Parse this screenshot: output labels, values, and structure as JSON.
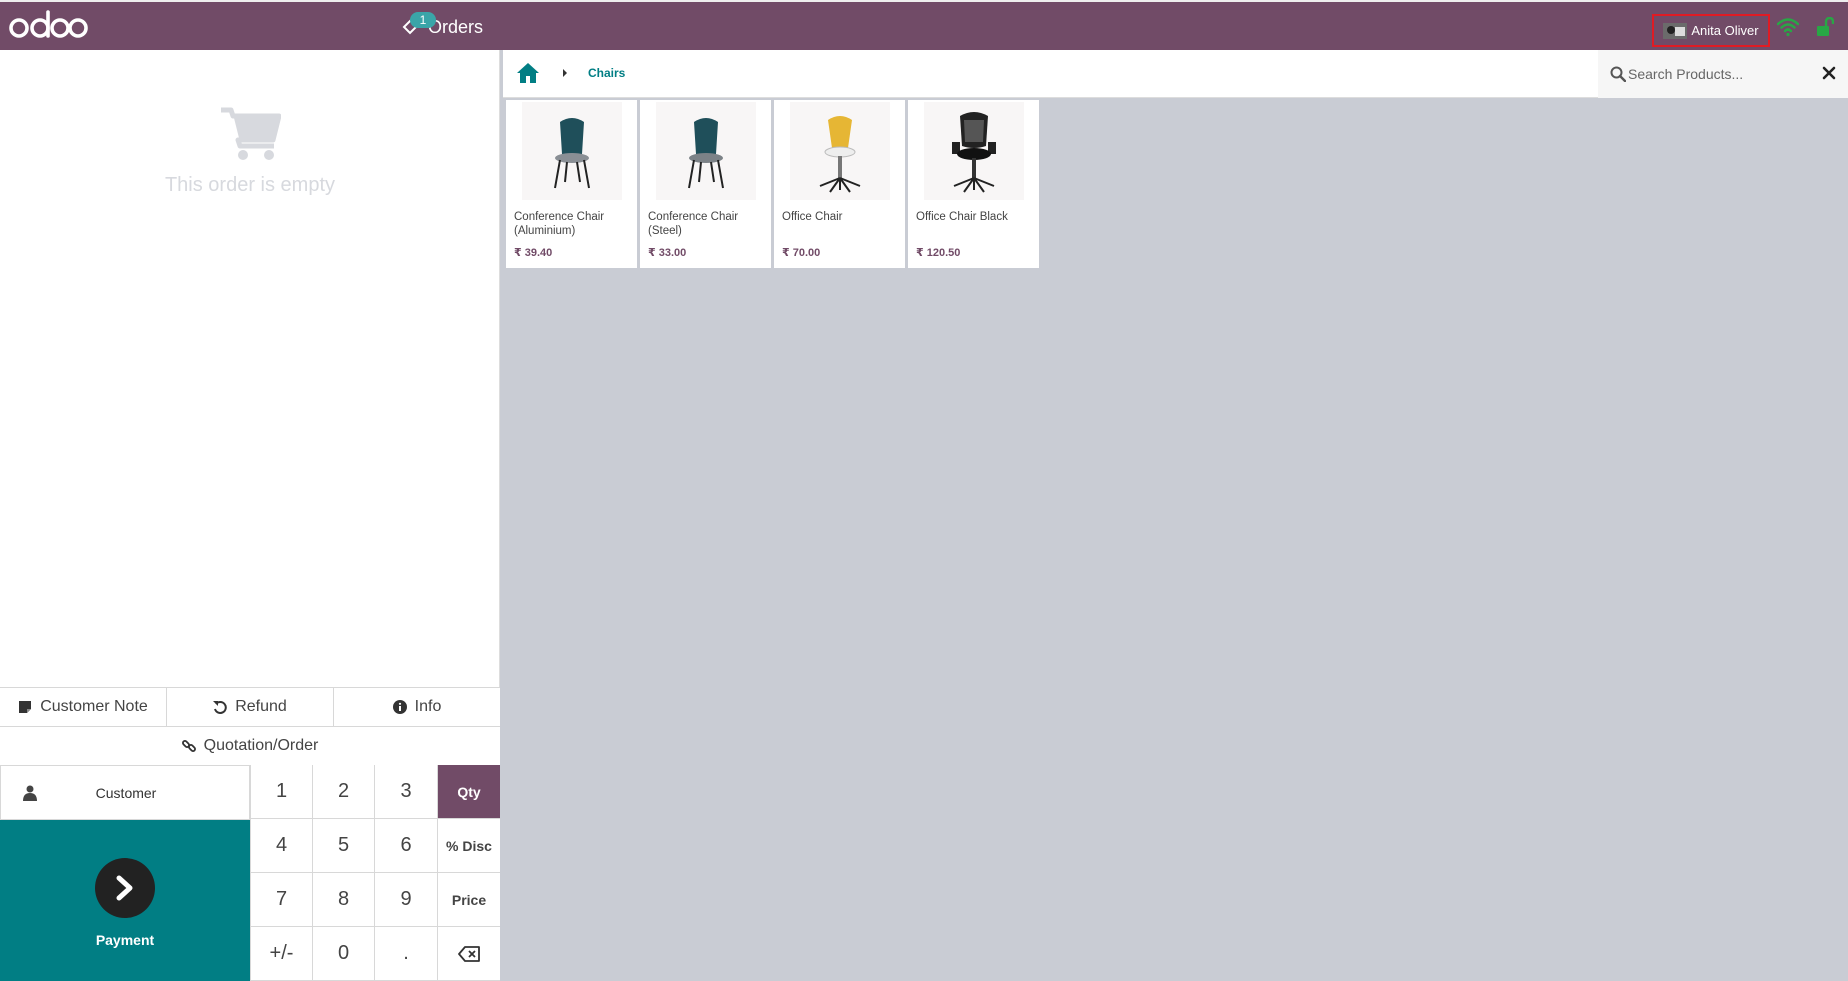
{
  "topbar": {
    "logo": "odoo",
    "orders_label": "Orders",
    "orders_count": "1",
    "cashier_name": "Anita Oliver",
    "colors": {
      "brand": "#714B67",
      "teal": "#017e84",
      "online": "#28a745"
    }
  },
  "order": {
    "empty_text": "This order is empty"
  },
  "controls": {
    "customer_note": "Customer Note",
    "refund": "Refund",
    "info": "Info",
    "quotation": "Quotation/Order"
  },
  "pad": {
    "customer": "Customer",
    "payment": "Payment",
    "keys": {
      "k1": "1",
      "k2": "2",
      "k3": "3",
      "qty": "Qty",
      "k4": "4",
      "k5": "5",
      "k6": "6",
      "disc": "% Disc",
      "k7": "7",
      "k8": "8",
      "k9": "9",
      "price": "Price",
      "sign": "+/-",
      "k0": "0",
      "dot": "."
    }
  },
  "categories": {
    "breadcrumb": "Chairs"
  },
  "search": {
    "placeholder": "Search Products..."
  },
  "products": [
    {
      "name": "Conference Chair (Aluminium)",
      "price": "₹ 39.40"
    },
    {
      "name": "Conference Chair (Steel)",
      "price": "₹ 33.00"
    },
    {
      "name": "Office Chair",
      "price": "₹ 70.00"
    },
    {
      "name": "Office Chair Black",
      "price": "₹ 120.50"
    }
  ]
}
